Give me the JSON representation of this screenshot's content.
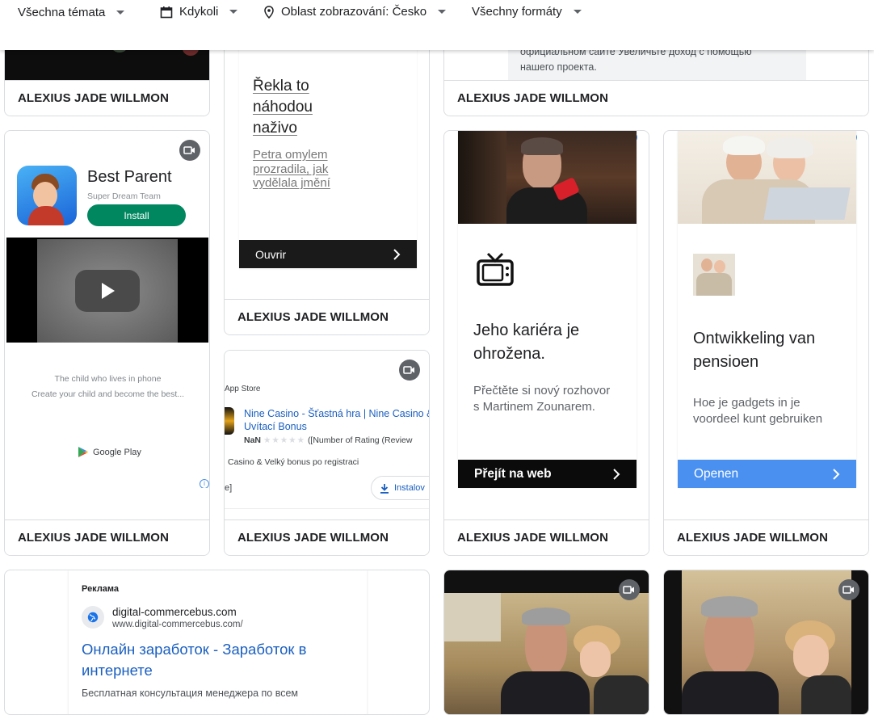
{
  "filters": {
    "topics": "Všechna témata",
    "when": "Kdykoli",
    "region": "Oblast zobrazování: Česko",
    "formats": "Všechny formáty"
  },
  "advertiser": "ALEXIUS JADE WILLMON",
  "cards": {
    "c1": {
      "footer": "ALEXIUS JADE WILLMON"
    },
    "c2": {
      "headline": "Řekla to náhodou naživo",
      "body": "Petra omylem prozradila, jak vydělala jmění",
      "cta": "Ouvrir",
      "footer": "ALEXIUS JADE WILLMON"
    },
    "c3": {
      "text_line1": "официальном сайте Увеличьте доход с помощью",
      "text_line2": "нашего проекта.",
      "footer": "ALEXIUS JADE WILLMON"
    },
    "c4": {
      "app_name": "Best Parent",
      "developer": "Super Dream Team",
      "install": "Install",
      "desc1": "The child who lives in phone",
      "desc2": "Create your child and become the best...",
      "store": "Google Play",
      "footer": "ALEXIUS JADE WILLMON"
    },
    "c5": {
      "store_label": "App Store",
      "title": "Nine Casino - Šťastná hra | Nine Casino & Uvítací Bonus",
      "rating_value": "NaN",
      "rating_text": "([Number of Rating (Review",
      "subtitle": "Casino & Velký bonus po registraci",
      "install_btn": "Instalov",
      "footer": "ALEXIUS JADE WILLMON"
    },
    "c6": {
      "headline": "Jeho kariéra je ohrožena.",
      "body": "Přečtěte si nový rozhovor s Martinem Zounarem.",
      "cta": "Přejít na web",
      "footer": "ALEXIUS JADE WILLMON"
    },
    "c7": {
      "headline": "Ontwikkeling van pensioen",
      "body": "Hoe je gadgets in je voordeel kunt gebruiken",
      "cta": "Openen",
      "footer": "ALEXIUS JADE WILLMON"
    },
    "c8": {
      "ad_label": "Реклама",
      "domain": "digital-commercebus.com",
      "url": "www.digital-commercebus.com/",
      "title": "Онлайн заработок - Заработок в интернете",
      "desc": "Бесплатная консультация менеджера по всем"
    }
  },
  "icons": {
    "calendar": "calendar-icon",
    "location": "location-pin-icon",
    "video": "video-camera-icon",
    "tv": "tv-icon",
    "play": "play-icon",
    "download": "download-icon",
    "globe": "globe-icon",
    "chevron": "chevron-right-icon"
  },
  "colors": {
    "install_green": "#01875f",
    "cta_dark": "#1a1a1a",
    "cta_blue": "#4a90f0",
    "link_blue": "#1a5fc0"
  }
}
